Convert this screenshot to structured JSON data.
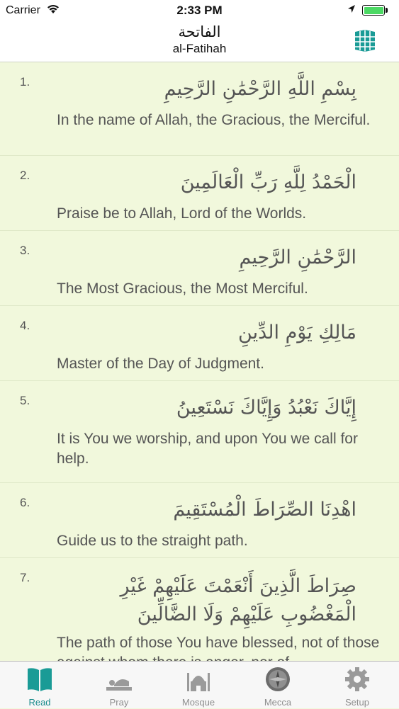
{
  "status_bar": {
    "carrier": "Carrier",
    "time": "2:33 PM"
  },
  "nav": {
    "title_arabic": "الفاتحة",
    "title_english": "al-Fatihah",
    "grid_icon": "grid-book-icon"
  },
  "verses": [
    {
      "number": "1.",
      "arabic": "بِسْمِ اللَّهِ الرَّحْمَٰنِ الرَّحِيمِ",
      "english": "In the name of Allah, the Gracious, the Merciful."
    },
    {
      "number": "2.",
      "arabic": "الْحَمْدُ لِلَّهِ رَبِّ الْعَالَمِينَ",
      "english": "Praise be to Allah, Lord of the Worlds."
    },
    {
      "number": "3.",
      "arabic": "الرَّحْمَٰنِ الرَّحِيمِ",
      "english": "The Most Gracious, the Most Merciful."
    },
    {
      "number": "4.",
      "arabic": "مَالِكِ يَوْمِ الدِّينِ",
      "english": "Master of the Day of Judgment."
    },
    {
      "number": "5.",
      "arabic": "إِيَّاكَ نَعْبُدُ وَإِيَّاكَ نَسْتَعِينُ",
      "english": "It is You we worship, and upon You we call for help."
    },
    {
      "number": "6.",
      "arabic": "اهْدِنَا الصِّرَاطَ الْمُسْتَقِيمَ",
      "english": "Guide us to the straight path."
    },
    {
      "number": "7.",
      "arabic": "صِرَاطَ الَّذِينَ أَنْعَمْتَ عَلَيْهِمْ غَيْرِ الْمَغْضُوبِ عَلَيْهِمْ وَلَا الضَّالِّينَ",
      "english": "The path of those You have blessed, not of those against whom there is anger, nor of"
    }
  ],
  "tabs": [
    {
      "label": "Read",
      "icon": "book-icon",
      "active": true
    },
    {
      "label": "Pray",
      "icon": "prayer-icon",
      "active": false
    },
    {
      "label": "Mosque",
      "icon": "mosque-icon",
      "active": false
    },
    {
      "label": "Mecca",
      "icon": "compass-icon",
      "active": false
    },
    {
      "label": "Setup",
      "icon": "gear-icon",
      "active": false
    }
  ],
  "colors": {
    "background": "#f1f8dc",
    "accent": "#1a8c8c",
    "text": "#555555"
  }
}
